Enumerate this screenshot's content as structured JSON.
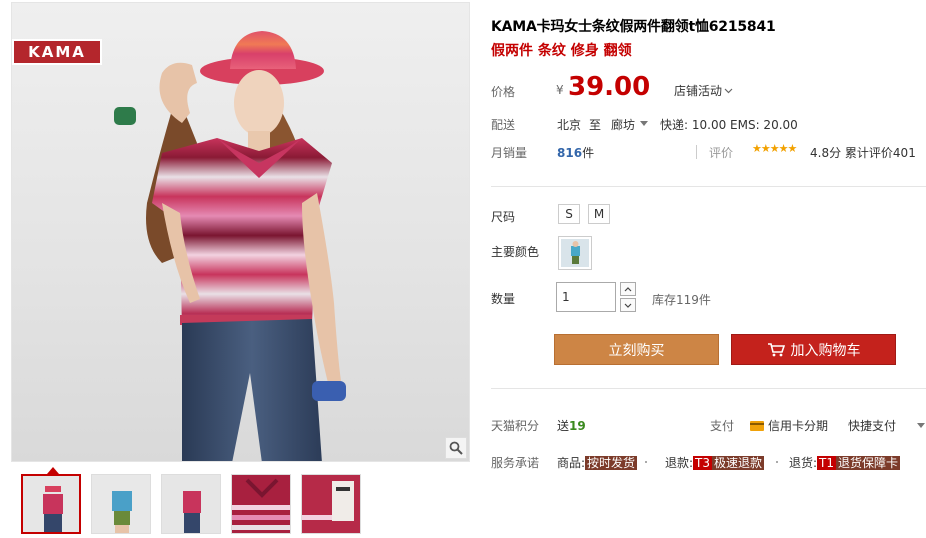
{
  "brand_logo": "KAMA",
  "product": {
    "title": "KAMA卡玛女士条纹假两件翻领t恤6215841",
    "subtitle": "假两件 条纹 修身 翻领"
  },
  "price": {
    "label": "价格",
    "currency": "¥",
    "value": "39.00",
    "promo": "店铺活动"
  },
  "shipping": {
    "label": "配送",
    "from": "北京",
    "to_word": "至",
    "destination": "廊坊",
    "fees": "快递: 10.00 EMS: 20.00"
  },
  "sales": {
    "label": "月销量",
    "count": "816",
    "unit": "件",
    "rating_label": "评价",
    "stars": "★★★★★",
    "score": "4.8分",
    "total_reviews": "累计评价401"
  },
  "options": {
    "size_label": "尺码",
    "sizes": [
      "S",
      "M"
    ],
    "color_label": "主要颜色",
    "qty_label": "数量",
    "qty_value": "1",
    "stock": "库存119件"
  },
  "actions": {
    "buy_now": "立刻购买",
    "add_cart": "加入购物车"
  },
  "tmall": {
    "points_label": "天猫积分",
    "points_prefix": "送",
    "points_value": "19",
    "pay_label": "支付",
    "credit": "信用卡分期",
    "quick_pay": "快捷支付"
  },
  "service": {
    "label": "服务承诺",
    "goods_prefix": "商品:",
    "goods_tag": "按时发货",
    "refund_prefix": "退款:",
    "refund_code": "T3",
    "refund_tag": "极速退款",
    "return_prefix": "退货:",
    "return_code": "T1",
    "return_tag": "退货保障卡"
  },
  "colors": {
    "accent_red": "#c40000",
    "buy_orange": "#cd8545",
    "cart_red": "#c4221c",
    "sales_blue": "#3366aa",
    "points_green": "#3a8a1e",
    "star_gold": "#f2a100"
  },
  "icons": [
    "zoom-icon",
    "cart-icon",
    "credit-card-icon",
    "chevron-down-icon",
    "stepper-up-icon",
    "stepper-down-icon"
  ]
}
